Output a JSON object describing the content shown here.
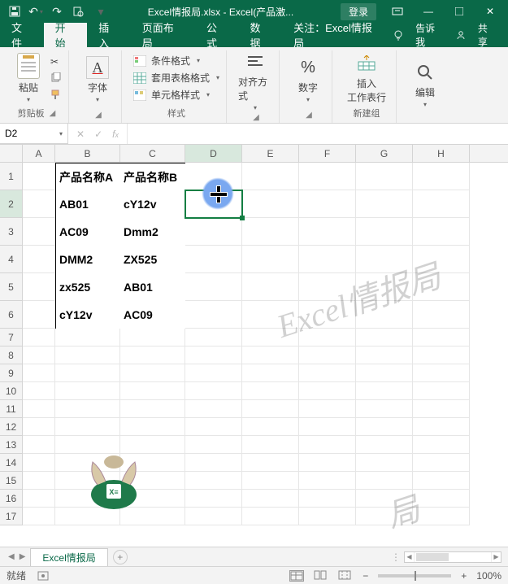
{
  "titlebar": {
    "filename": "Excel情报局.xlsx",
    "appname": "Excel(产品激...",
    "login": "登录"
  },
  "tabs": {
    "file": "文件",
    "home": "开始",
    "insert": "插入",
    "layout": "页面布局",
    "formulas": "公式",
    "data": "数据",
    "attention": "关注：Excel情报局",
    "tellme": "告诉我",
    "share": "共享"
  },
  "ribbon": {
    "clipboard": {
      "paste": "粘贴",
      "label": "剪贴板"
    },
    "font": {
      "big": "字体"
    },
    "styles": {
      "cond": "条件格式",
      "tablefmt": "套用表格格式",
      "cellstyle": "单元格样式",
      "label": "样式"
    },
    "align": {
      "big": "对齐方式"
    },
    "number": {
      "big": "数字"
    },
    "insertgrp": {
      "big": "插入\n工作表行",
      "label": "新建组"
    },
    "edit": {
      "big": "编辑"
    }
  },
  "namebox": "D2",
  "sheet": {
    "cols": [
      "A",
      "B",
      "C",
      "D",
      "E",
      "F",
      "G",
      "H"
    ],
    "data_rows": [
      {
        "b": "产品名称A",
        "c": "产品名称B"
      },
      {
        "b": "AB01",
        "c": "cY12v"
      },
      {
        "b": "AC09",
        "c": "Dmm2"
      },
      {
        "b": "DMM2",
        "c": "ZX525"
      },
      {
        "b": "zx525",
        "c": "AB01"
      },
      {
        "b": "cY12v",
        "c": "AC09"
      }
    ],
    "watermark": "Excel情报局"
  },
  "sheettab": "Excel情报局",
  "status": {
    "ready": "就绪",
    "zoom": "100%"
  }
}
